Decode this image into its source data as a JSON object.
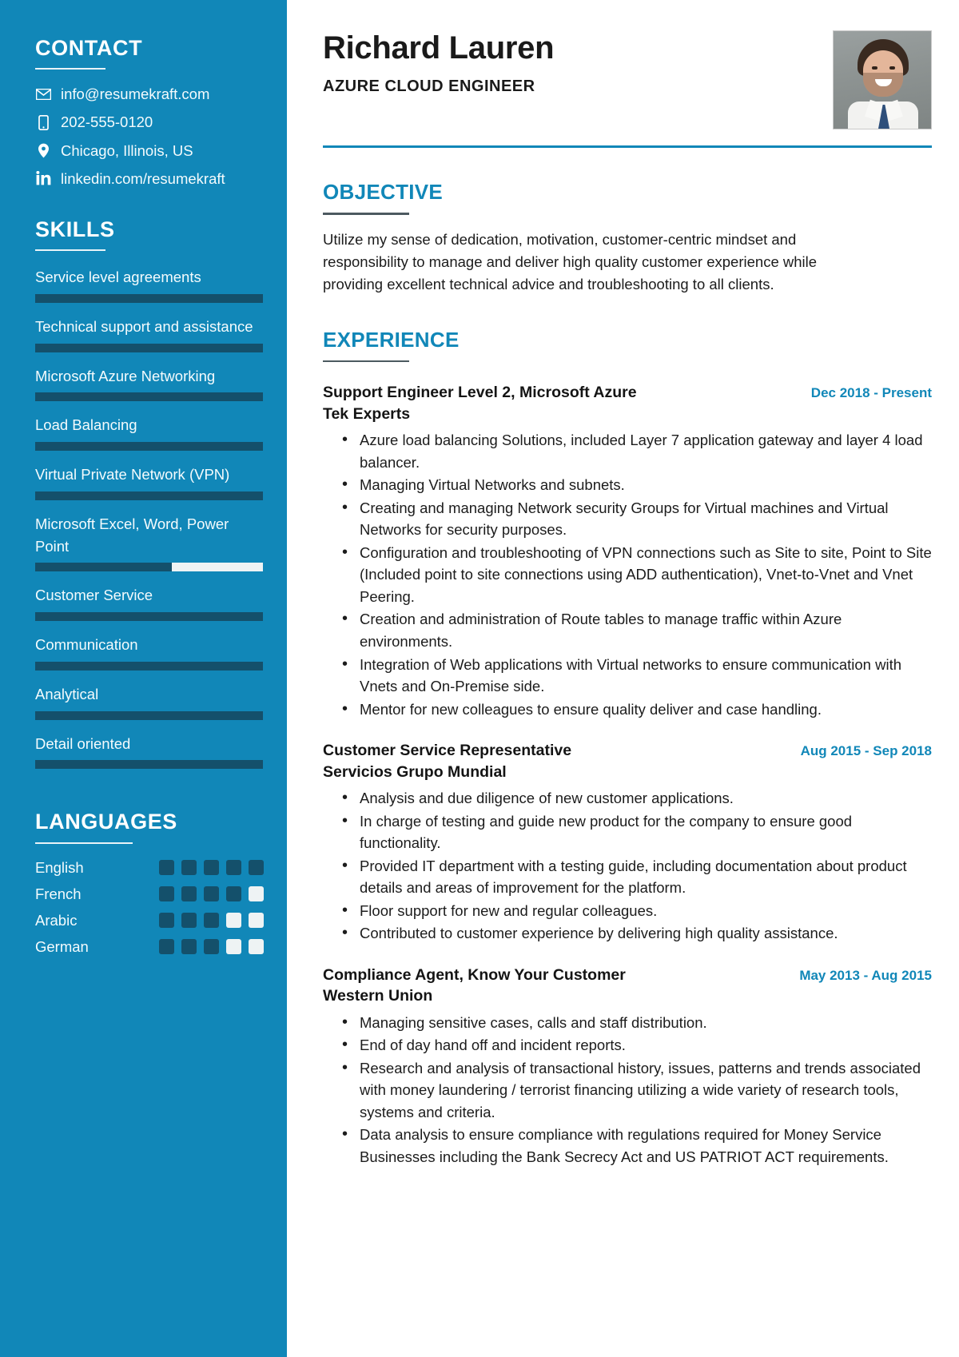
{
  "theme": {
    "sidebar_bg": "#1187b8",
    "accent": "#1187b8",
    "bar_fill": "#14506b",
    "bar_track": "#eef3f4"
  },
  "sidebar": {
    "contact": {
      "heading": "CONTACT",
      "items": [
        {
          "icon": "envelope-icon",
          "value": "info@resumekraft.com"
        },
        {
          "icon": "phone-icon",
          "value": "202-555-0120"
        },
        {
          "icon": "location-pin-icon",
          "value": "Chicago, Illinois, US"
        },
        {
          "icon": "linkedin-icon",
          "value": "linkedin.com/resumekraft"
        }
      ]
    },
    "skills": {
      "heading": "SKILLS",
      "items": [
        {
          "name": "Service level agreements",
          "level": 100
        },
        {
          "name": "Technical support and assistance",
          "level": 100
        },
        {
          "name": "Microsoft Azure Networking",
          "level": 100
        },
        {
          "name": "Load Balancing",
          "level": 100
        },
        {
          "name": "Virtual Private Network (VPN)",
          "level": 100
        },
        {
          "name": "Microsoft Excel, Word, Power Point",
          "level": 60
        },
        {
          "name": "Customer Service",
          "level": 100
        },
        {
          "name": "Communication",
          "level": 100
        },
        {
          "name": "Analytical",
          "level": 100
        },
        {
          "name": "Detail oriented",
          "level": 100
        }
      ]
    },
    "languages": {
      "heading": "LANGUAGES",
      "max": 5,
      "items": [
        {
          "name": "English",
          "level": 5
        },
        {
          "name": "French",
          "level": 4
        },
        {
          "name": "Arabic",
          "level": 3
        },
        {
          "name": "German",
          "level": 3
        }
      ]
    }
  },
  "header": {
    "name": "Richard Lauren",
    "title": "AZURE CLOUD ENGINEER",
    "photo_alt": "profile-photo"
  },
  "objective": {
    "heading": "OBJECTIVE",
    "text": "Utilize my sense of dedication, motivation, customer-centric mindset and responsibility to manage and deliver high quality customer experience while providing excellent technical advice and troubleshooting to all clients."
  },
  "experience": {
    "heading": "EXPERIENCE",
    "items": [
      {
        "role": "Support Engineer Level 2, Microsoft Azure",
        "company": "Tek Experts",
        "date": "Dec 2018 - Present",
        "bullets": [
          "Azure load balancing Solutions, included Layer 7 application gateway and layer 4 load balancer.",
          "Managing Virtual Networks and subnets.",
          "Creating and managing Network security Groups for Virtual machines and Virtual Networks for security purposes.",
          "Configuration and troubleshooting of VPN connections such as Site to site, Point to Site (Included point to site connections using ADD authentication), Vnet-to-Vnet and Vnet Peering.",
          "Creation and administration of Route tables to manage traffic within Azure environments.",
          "Integration of Web applications with Virtual networks to ensure communication with Vnets and On-Premise side.",
          "Mentor for new colleagues to ensure quality deliver and case handling."
        ]
      },
      {
        "role": "Customer Service Representative",
        "company": "Servicios Grupo Mundial",
        "date": "Aug 2015 - Sep 2018",
        "bullets": [
          "Analysis and due diligence of new customer applications.",
          "In charge of testing and guide new product for the company to ensure good functionality.",
          "Provided IT department with a testing guide, including documentation about product details and areas of improvement for the platform.",
          "Floor support for new and regular colleagues.",
          "Contributed to customer experience by delivering high quality assistance."
        ]
      },
      {
        "role": "Compliance Agent, Know Your Customer",
        "company": "Western Union",
        "date": "May 2013 - Aug 2015",
        "bullets": [
          "Managing sensitive cases, calls and staff distribution.",
          "End of day hand off and incident reports.",
          "Research and analysis of transactional history, issues, patterns and trends associated with money laundering / terrorist financing utilizing a wide variety of research tools, systems and criteria.",
          "Data analysis to ensure compliance with regulations required for Money Service Businesses including the Bank Secrecy Act and US PATRIOT ACT requirements."
        ]
      }
    ]
  }
}
